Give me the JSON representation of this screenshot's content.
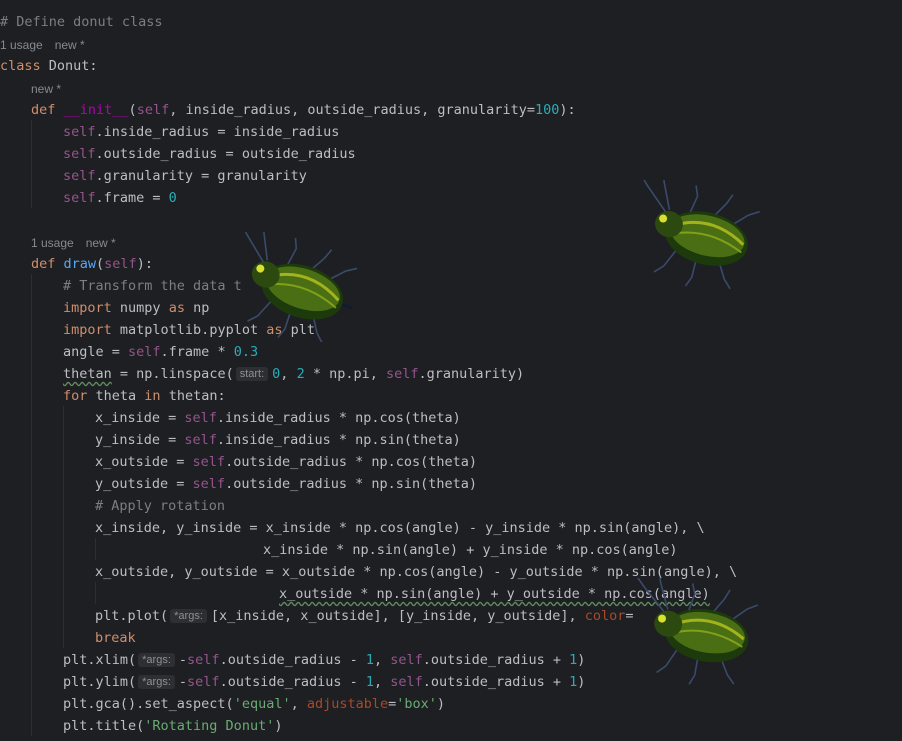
{
  "code": {
    "l1": "# Define donut class",
    "l2_usage": "1 usage",
    "l2_new": "new *",
    "l3_kw": "class",
    "l3_name": " Donut:",
    "l4_new": "new *",
    "l5_def": "def ",
    "l5_init": "__init__",
    "l5_open": "(",
    "l5_self": "self",
    "l5_params": ", inside_radius, outside_radius, granularity=",
    "l5_num": "100",
    "l5_close": "):",
    "l6_self": "self",
    "l6_rest": ".inside_radius = inside_radius",
    "l7_self": "self",
    "l7_rest": ".outside_radius = outside_radius",
    "l8_self": "self",
    "l8_rest": ".granularity = granularity",
    "l9_self": "self",
    "l9_rest": ".frame = ",
    "l9_num": "0",
    "l10_usage": "1 usage",
    "l10_new": "new *",
    "l11_def": "def ",
    "l11_name": "draw",
    "l11_open": "(",
    "l11_self": "self",
    "l11_close": "):",
    "l12": "# Transform the data t",
    "l13_kw": "import",
    "l13_mod": " numpy ",
    "l13_as": "as",
    "l13_alias": " np",
    "l14_kw": "import",
    "l14_mod": " matplotlib.pyplot ",
    "l14_as": "as",
    "l14_alias": " plt",
    "l15_a": "angle = ",
    "l15_self": "self",
    "l15_b": ".frame * ",
    "l15_num": "0.3",
    "l16_a": "thetan",
    "l16_b": " = np.linspace(",
    "l16_hint": "start:",
    "l16_num0": "0",
    "l16_c": ", ",
    "l16_num2": "2",
    "l16_d": " * np.pi, ",
    "l16_self": "self",
    "l16_e": ".granularity)",
    "l17_for": "for",
    "l17_a": " theta ",
    "l17_in": "in",
    "l17_b": " thetan:",
    "l18_a": "x_inside = ",
    "l18_self": "self",
    "l18_b": ".inside_radius * np.cos(theta)",
    "l19_a": "y_inside = ",
    "l19_self": "self",
    "l19_b": ".inside_radius * np.sin(theta)",
    "l20_a": "x_outside = ",
    "l20_self": "self",
    "l20_b": ".outside_radius * np.cos(theta)",
    "l21_a": "y_outside = ",
    "l21_self": "self",
    "l21_b": ".outside_radius * np.sin(theta)",
    "l22": "# Apply rotation",
    "l23": "x_inside, y_inside = x_inside * np.cos(angle) - y_inside * np.sin(angle), \\",
    "l24": "x_inside * np.sin(angle) + y_inside * np.cos(angle)",
    "l25": "x_outside, y_outside = x_outside * np.cos(angle) - y_outside * np.sin(angle), \\",
    "l26": "x_outside * np.sin(angle) + y_outside * np.cos(angle)",
    "l27_a": "plt.plot(",
    "l27_hint": "*args:",
    "l27_b": "[x_inside, x_outside], [y_inside, y_outside], ",
    "l27_param": "color",
    "l27_eq": "=",
    "l28_kw": "break",
    "l29_a": "plt.xlim(",
    "l29_hint": "*args:",
    "l29_b": "-",
    "l29_self1": "self",
    "l29_c": ".outside_radius - ",
    "l29_num1": "1",
    "l29_d": ", ",
    "l29_self2": "self",
    "l29_e": ".outside_radius + ",
    "l29_num2": "1",
    "l29_f": ")",
    "l30_a": "plt.ylim(",
    "l30_hint": "*args:",
    "l30_b": "-",
    "l30_self1": "self",
    "l30_c": ".outside_radius - ",
    "l30_num1": "1",
    "l30_d": ", ",
    "l30_self2": "self",
    "l30_e": ".outside_radius + ",
    "l30_num2": "1",
    "l30_f": ")",
    "l31_a": "plt.gca().set_aspect(",
    "l31_str1": "'equal'",
    "l31_b": ", ",
    "l31_param": "adjustable",
    "l31_c": "=",
    "l31_str2": "'box'",
    "l31_d": ")",
    "l32_a": "plt.title(",
    "l32_str": "'Rotating Donut'",
    "l32_b": ")"
  },
  "overlays": {
    "beetle_icon": "leaf-beetle-icon",
    "beetle_colors": [
      "#1c3a0c",
      "#6a8f1a",
      "#c8d020",
      "#0d1a3a"
    ]
  },
  "theme": {
    "background": "#1e1f22",
    "keyword": "#cf8e6d",
    "self": "#94558d",
    "number": "#2aacb8",
    "string": "#6aab73",
    "comment": "#7a7e85"
  }
}
